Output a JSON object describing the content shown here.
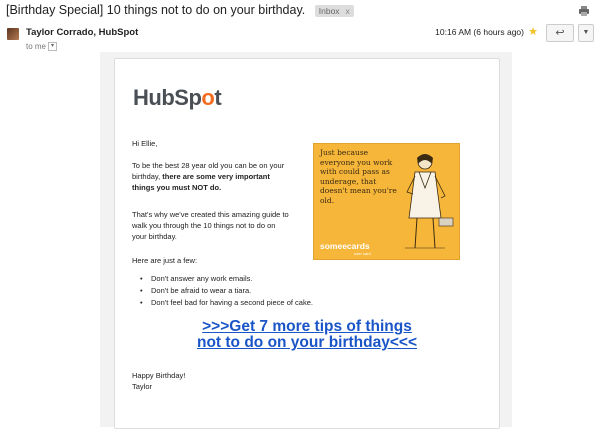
{
  "subject": "[Birthday Special] 10 things not to do on your birthday.",
  "label": {
    "text": "Inbox",
    "close": "x"
  },
  "sender": {
    "name": "Taylor Corrado, HubSpot",
    "to": "to me"
  },
  "time": "10:16 AM (6 hours ago)",
  "logo": {
    "text_a": "HubSp",
    "text_b": "o",
    "text_c": "t"
  },
  "email": {
    "greeting": "Hi Ellie,",
    "p1_a": "To be the best 28 year old you can be on your birthday, ",
    "p1_b": "there are some very important things you must NOT do.",
    "p2": "That's why we've created this amazing guide to walk you through the 10 things not to do on your birthday.",
    "p3": "Here are just a few:",
    "tips": [
      "Don't answer any work emails.",
      "Don't be afraid to wear a tiara.",
      "Don't feel bad for having a second piece of cake."
    ],
    "cta_line1": ">>>Get 7 more tips of things",
    "cta_line2": "not to do on your birthday<<<",
    "signoff_1": "Happy Birthday!",
    "signoff_2": "Taylor"
  },
  "ecard": {
    "text": "Just because everyone you work with could pass as underage, that doesn't mean you're old.",
    "brand": "someecards",
    "tag": "user card"
  },
  "colors": {
    "accent": "#f26c21",
    "link": "#1a55c8",
    "ecard_bg": "#f6b63a"
  }
}
